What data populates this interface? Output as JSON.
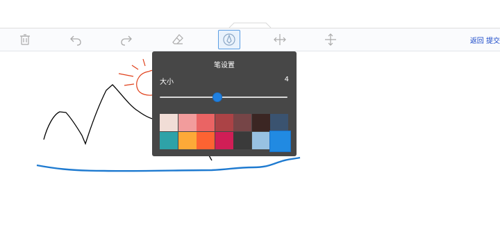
{
  "toolbar": {
    "tools": [
      {
        "name": "delete",
        "icon": "trash-icon"
      },
      {
        "name": "undo",
        "icon": "undo-icon"
      },
      {
        "name": "redo",
        "icon": "redo-icon"
      },
      {
        "name": "eraser",
        "icon": "eraser-icon"
      },
      {
        "name": "pen",
        "icon": "pen-icon",
        "active": true
      },
      {
        "name": "expand-horizontal",
        "icon": "arrows-horizontal-icon"
      },
      {
        "name": "expand-vertical",
        "icon": "arrows-vertical-icon"
      }
    ],
    "back_label": "返回",
    "submit_label": "提交"
  },
  "pen_panel": {
    "title": "笔设置",
    "size_label": "大小",
    "size_value": "4",
    "size_slider_fraction": 0.45,
    "colors": [
      [
        "#f1ddd6",
        "#f29c9c",
        "#ea6464",
        "#ab4346",
        "#764547",
        "#3b2623",
        "#3a5370"
      ],
      [
        "#2ea2a8",
        "#fda938",
        "#fd6332",
        "#d01e56",
        "#3a3a3a",
        "#98c1e2",
        "#218ae2"
      ]
    ],
    "selected_color": "#218ae2"
  },
  "drawing": {
    "stroke_colors": {
      "mountain": "#000000",
      "sun": "#e0401a",
      "ground": "#1e7ad0"
    }
  }
}
